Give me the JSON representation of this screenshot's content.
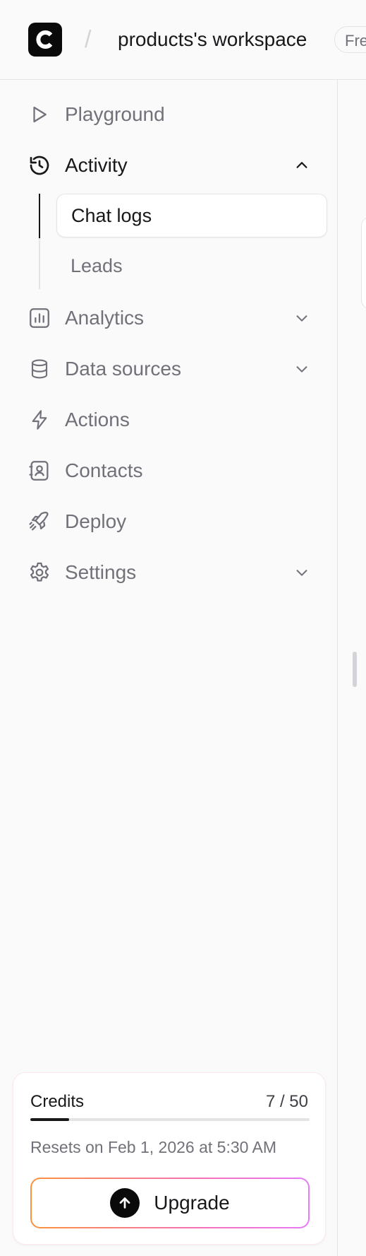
{
  "header": {
    "workspace_name": "products's workspace",
    "plan_badge": "Free"
  },
  "sidebar": {
    "items": [
      {
        "label": "Playground",
        "icon": "play-icon"
      },
      {
        "label": "Activity",
        "icon": "history-icon",
        "expanded": true
      },
      {
        "label": "Analytics",
        "icon": "chart-icon"
      },
      {
        "label": "Data sources",
        "icon": "database-icon"
      },
      {
        "label": "Actions",
        "icon": "bolt-icon"
      },
      {
        "label": "Contacts",
        "icon": "contact-icon"
      },
      {
        "label": "Deploy",
        "icon": "rocket-icon"
      },
      {
        "label": "Settings",
        "icon": "gear-icon"
      }
    ],
    "activity_sub": [
      {
        "label": "Chat logs",
        "selected": true
      },
      {
        "label": "Leads",
        "selected": false
      }
    ]
  },
  "credits": {
    "title": "Credits",
    "used": 7,
    "total": 50,
    "count_text": "7 / 50",
    "reset_text": "Resets on Feb 1, 2026 at 5:30 AM",
    "upgrade_label": "Upgrade"
  },
  "colors": {
    "text_primary": "#18181b",
    "text_muted": "#71717a",
    "border": "#e4e4e7",
    "upgrade_gradient": [
      "#fb923c",
      "#e879f9"
    ]
  }
}
